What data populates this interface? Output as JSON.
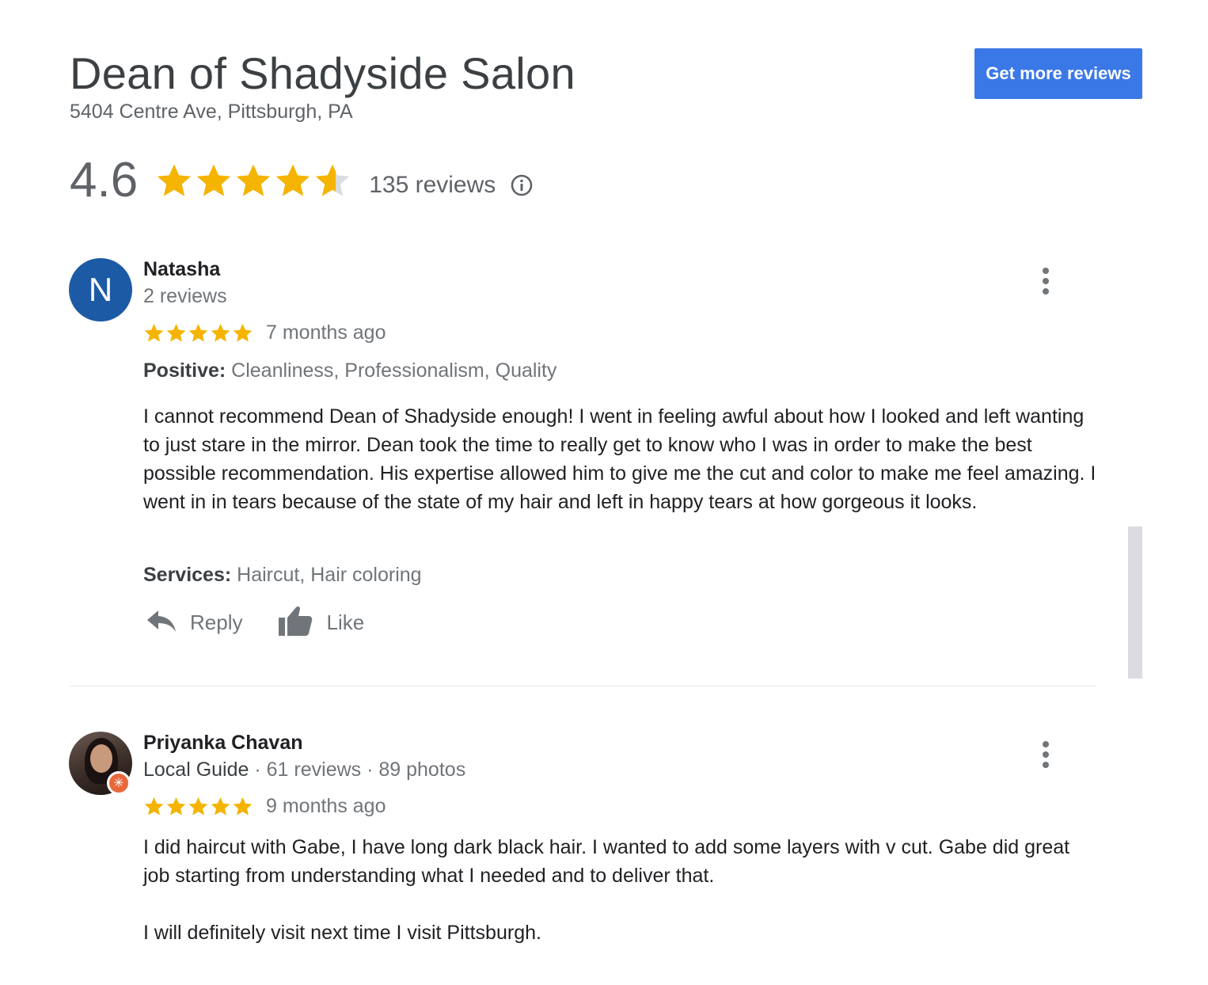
{
  "business": {
    "name": "Dean of Shadyside Salon",
    "address": "5404 Centre Ave, Pittsburgh, PA",
    "cta_label": "Get more reviews",
    "rating": "4.6",
    "rating_value": 4.6,
    "review_count": "135 reviews"
  },
  "reviews": [
    {
      "avatar_letter": "N",
      "name": "Natasha",
      "meta": "2 reviews",
      "stars": 5,
      "date": "7 months ago",
      "positive_label": "Positive:",
      "positive_value": "Cleanliness, Professionalism, Quality",
      "text": "I cannot recommend Dean of Shadyside enough! I went in feeling awful about how I looked and left wanting to just stare in the mirror. Dean took the time to really get to know who I was in order to make the best possible recommendation. His expertise allowed him to give me the cut and color to make me feel amazing. I went in in tears because of the state of my hair and left in happy tears at how gorgeous it looks.",
      "services_label": "Services:",
      "services_value": "Haircut, Hair coloring",
      "reply_label": "Reply",
      "like_label": "Like"
    },
    {
      "name": "Priyanka Chavan",
      "guide_label": "Local Guide",
      "meta_sep": " · ",
      "reviews_meta": "61 reviews",
      "photos_meta": "89 photos",
      "stars": 5,
      "date": "9 months ago",
      "text_p1": "I did haircut with Gabe, I have long dark black hair. I wanted to add some layers with v cut. Gabe did great job starting from understanding what I needed and to deliver that.",
      "text_p2": "I will definitely visit next time I visit Pittsburgh."
    }
  ],
  "colors": {
    "star_gold": "#f4b400",
    "star_empty": "#dadce0",
    "cta_blue": "#3b78e7",
    "avatar_blue": "#1d5aa5",
    "guide_orange": "#e8683b"
  },
  "icons": {
    "star": "star-icon",
    "info": "info-icon",
    "reply": "reply-icon",
    "like": "thumbs-up-icon",
    "more": "more-vert-icon",
    "guide_badge": "local-guide-badge-icon"
  }
}
